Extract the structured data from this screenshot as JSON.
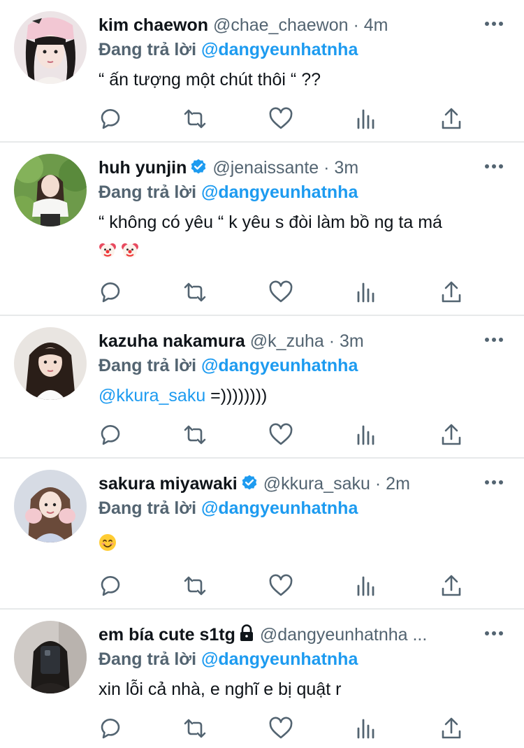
{
  "tweets": [
    {
      "name": "kim chaewon",
      "handle": "@chae_chaewon",
      "dot": "·",
      "time": "4m",
      "verified": false,
      "locked": false,
      "reply_prefix": "Đang trả lời ",
      "reply_handle": "@dangyeunhatnha",
      "text": "“ ấn tượng một chút thôi “ ??"
    },
    {
      "name": "huh yunjin",
      "handle": "@jenaissante",
      "dot": "·",
      "time": "3m",
      "verified": true,
      "locked": false,
      "reply_prefix": "Đang trả lời ",
      "reply_handle": "@dangyeunhatnha",
      "text": "“ không có yêu “ k yêu s đòi làm bồ ng ta má",
      "emojis": [
        "clown-face-emoji",
        "clown-face-emoji"
      ]
    },
    {
      "name": "kazuha nakamura",
      "handle": "@k_zuha",
      "dot": "·",
      "time": "3m",
      "verified": false,
      "locked": false,
      "reply_prefix": "Đang trả lời ",
      "reply_handle": "@dangyeunhatnha",
      "text_mention": "@kkura_saku",
      "text": " =))))))))"
    },
    {
      "name": "sakura miyawaki",
      "handle": "@kkura_saku",
      "dot": "·",
      "time": "2m",
      "verified": true,
      "locked": false,
      "reply_prefix": "Đang trả lời ",
      "reply_handle": "@dangyeunhatnha",
      "emojis": [
        "smiling-face-emoji"
      ]
    },
    {
      "name": "em bía cute s1tg",
      "handle": "@dangyeunhatnha ...",
      "verified": false,
      "locked": true,
      "reply_prefix": "Đang trả lời ",
      "reply_handle": "@dangyeunhatnha",
      "text": "xin lỗi cả nhà, e nghĩ e bị quật r"
    }
  ],
  "actions": [
    "reply-icon",
    "retweet-icon",
    "like-icon",
    "analytics-icon",
    "share-icon"
  ],
  "colors": {
    "link": "#1d9bf0",
    "secondary": "#536471",
    "divider": "#e7e9ea",
    "verified": "#1d9bf0"
  }
}
